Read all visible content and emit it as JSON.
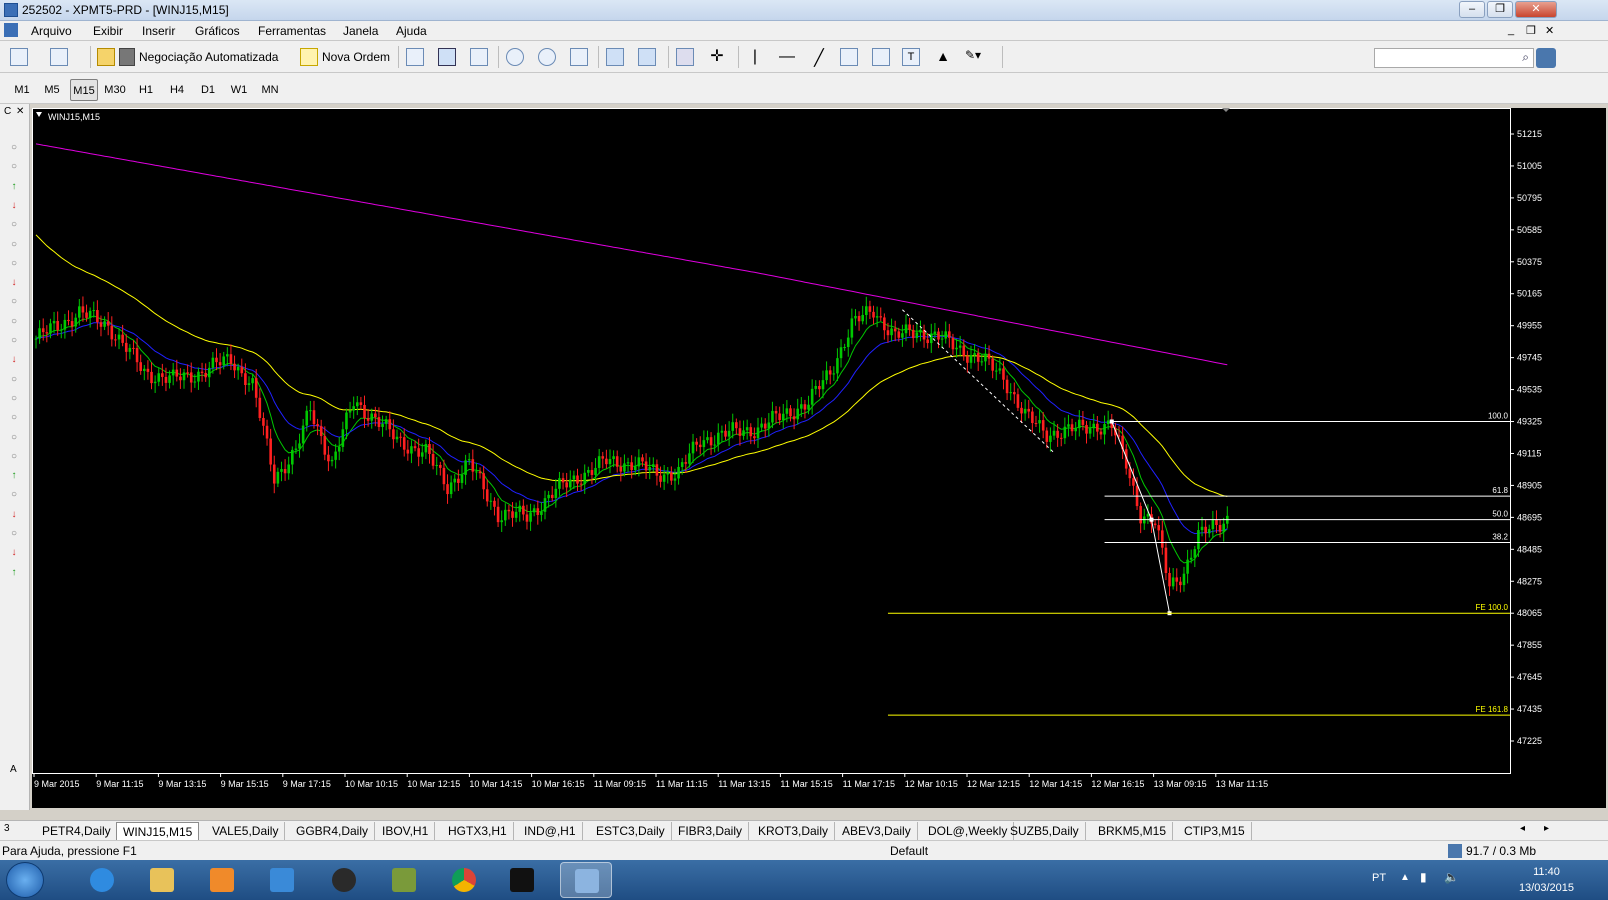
{
  "window": {
    "title": "252502 - XPMT5-PRD - [WINJ15,M15]"
  },
  "menu": [
    "Arquivo",
    "Exibir",
    "Inserir",
    "Gráficos",
    "Ferramentas",
    "Janela",
    "Ajuda"
  ],
  "toolbar": {
    "auto_trading": "Negociação Automatizada",
    "new_order": "Nova Ordem"
  },
  "timeframes": [
    "M1",
    "M5",
    "M15",
    "M30",
    "H1",
    "H4",
    "D1",
    "W1",
    "MN"
  ],
  "selected_timeframe": "M15",
  "chart": {
    "symbol_label": "WINJ15,M15",
    "price_ticks": [
      "51215",
      "51005",
      "50795",
      "50585",
      "50375",
      "50165",
      "49955",
      "49745",
      "49535",
      "49325",
      "49115",
      "48905",
      "48695",
      "48485",
      "48275",
      "48065",
      "47855",
      "47645",
      "47435",
      "47225"
    ],
    "time_ticks": [
      "9 Mar 2015",
      "9 Mar 11:15",
      "9 Mar 13:15",
      "9 Mar 15:15",
      "9 Mar 17:15",
      "10 Mar 10:15",
      "10 Mar 12:15",
      "10 Mar 14:15",
      "10 Mar 16:15",
      "11 Mar 09:15",
      "11 Mar 11:15",
      "11 Mar 13:15",
      "11 Mar 15:15",
      "11 Mar 17:15",
      "12 Mar 10:15",
      "12 Mar 12:15",
      "12 Mar 14:15",
      "12 Mar 16:15",
      "13 Mar 09:15",
      "13 Mar 11:15"
    ],
    "fib_levels": [
      {
        "label": "100.0",
        "price": 49325
      },
      {
        "label": "61.8",
        "price": 48835
      },
      {
        "label": "50.0",
        "price": 48680
      },
      {
        "label": "38.2",
        "price": 48530
      }
    ],
    "fe_levels": [
      {
        "label": "FE 100.0",
        "price": 48065
      },
      {
        "label": "FE 161.8",
        "price": 47395
      }
    ],
    "colors": {
      "up": "#00c800",
      "down": "#ff2020",
      "ma_fast": "#00c800",
      "ma_mid": "#2020ff",
      "ma_slow": "#ffff00",
      "ma_long": "#e000e0",
      "fib": "#ffffff",
      "fe": "#ffff00"
    }
  },
  "sheets": [
    "PETR4,Daily",
    "WINJ15,M15",
    "VALE5,Daily",
    "GGBR4,Daily",
    "IBOV,H1",
    "HGTX3,H1",
    "IND@,H1",
    "ESTC3,Daily",
    "FIBR3,Daily",
    "KROT3,Daily",
    "ABEV3,Daily",
    "DOL@,Weekly",
    "SUZB5,Daily",
    "BRKM5,M15",
    "CTIP3,M15"
  ],
  "active_sheet": "WINJ15,M15",
  "status": {
    "help": "Para Ajuda, pressione F1",
    "profile": "Default",
    "traffic": "91.7 / 0.3 Mb"
  },
  "taskbar": {
    "lang": "PT",
    "time": "11:40",
    "date": "13/03/2015"
  }
}
